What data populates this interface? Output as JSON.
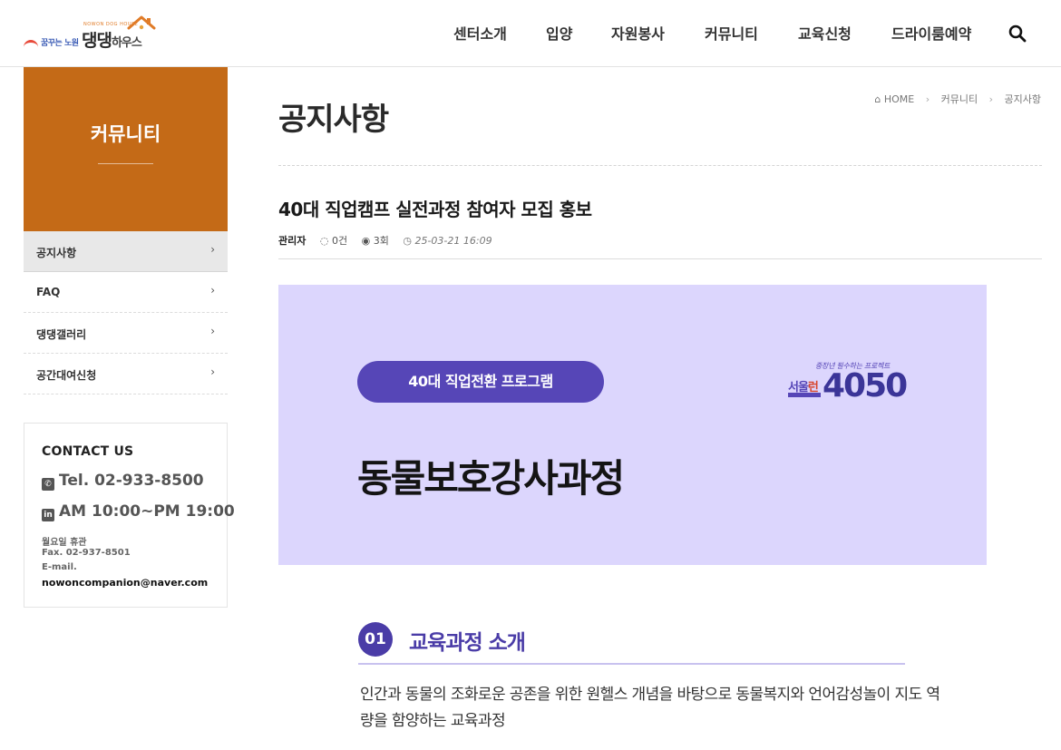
{
  "header": {
    "logo": {
      "tagline": "꿈꾸는 노원",
      "sub": "NOWON DOG HOUSE",
      "brand_main": "댕댕",
      "brand_small": "하우스"
    },
    "nav": [
      "센터소개",
      "입양",
      "자원봉사",
      "커뮤니티",
      "교육신청",
      "드라이룸예약"
    ],
    "search_icon": "search-icon"
  },
  "sidebar": {
    "title": "커뮤니티",
    "items": [
      {
        "label": "공지사항",
        "active": true
      },
      {
        "label": "FAQ",
        "active": false
      },
      {
        "label": "댕댕갤러리",
        "active": false
      },
      {
        "label": "공간대여신청",
        "active": false
      }
    ],
    "arrow": "›",
    "contact": {
      "title": "CONTACT US",
      "tel": "Tel. 02-933-8500",
      "hours": "AM 10:00~PM 19:00",
      "closed": "월요일 휴관",
      "fax": "Fax. 02-937-8501",
      "email_label": "E-mail.",
      "email": "nowoncompanion@naver.com"
    }
  },
  "main": {
    "page_title": "공지사항",
    "breadcrumb": {
      "home": "HOME",
      "level1": "커뮤니티",
      "level2": "공지사항",
      "separator": "›"
    },
    "post": {
      "title": "40대 직업캠프 실전과정 참여자 모집 홍보",
      "author": "관리자",
      "comments": "0건",
      "views": "3회",
      "date": "25-03-21 16:09"
    },
    "banner": {
      "pill": "40대 직업전환 프로그램",
      "title": "동물보호강사과정",
      "logo_tag": "중장년 필수하는 프로젝트",
      "logo_seoul_a": "서울",
      "logo_seoul_b": "런",
      "logo_num": "4050",
      "bg_color": "#dcd6fd",
      "accent": "#5646b7"
    },
    "section": {
      "num": "01",
      "title": "교육과정 소개",
      "text": "인간과 동물의 조화로운 공존을 위한 원헬스 개념을 바탕으로 동물복지와 언어감성놀이 지도 역량을 함양하는 교육과정"
    }
  },
  "colors": {
    "sidebar_head": "#c46a17",
    "section_accent": "#4a3ca7"
  }
}
